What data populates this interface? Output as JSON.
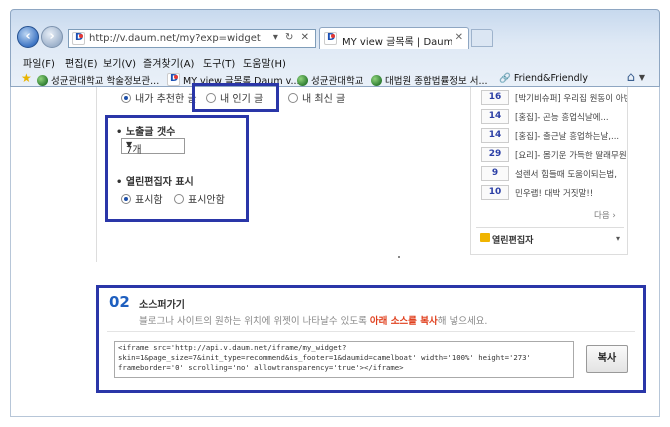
{
  "browser": {
    "address_url": "http://v.daum.net/my?exp=widget",
    "address_controls": "▾ ↻ ✕",
    "tab_title": "MY view 글목록 | Daum vi...",
    "tab_close": "✕",
    "menu": [
      "파일(F)",
      "편집(E)",
      "보기(V)",
      "즐겨찾기(A)",
      "도구(T)",
      "도움말(H)"
    ],
    "favorites": [
      {
        "label": "성균관대학교 학술정보관...",
        "icon": "globe-icon"
      },
      {
        "label": "MY view 글목록 Daum v...",
        "icon": "daum-icon"
      },
      {
        "label": "성균관대학교",
        "icon": "globe-icon"
      },
      {
        "label": "대법원 종합법률정보 서...",
        "icon": "globe-icon"
      },
      {
        "label": "Friend&Friendly",
        "icon": "link-icon"
      }
    ]
  },
  "widget_options": {
    "list_type": {
      "options": [
        "내가 추천한 글",
        "내 인기 글",
        "내 최신 글"
      ],
      "selected": "내가 추천한 글"
    },
    "count": {
      "label": "노출글 갯수",
      "value": "7개"
    },
    "editor_display": {
      "label": "열린편집자 표시",
      "options": [
        "표시함",
        "표시안함"
      ],
      "selected": "표시함"
    }
  },
  "preview_list": {
    "items": [
      {
        "count": "16",
        "title": "[박기비슈퍼] 우리집 원동이 아빈"
      },
      {
        "count": "14",
        "title": "[홍집]- 곤능 흥업식날에..."
      },
      {
        "count": "14",
        "title": "[홍집]- 출근날 흥업하는날,..."
      },
      {
        "count": "29",
        "title": "[요리]- 몸기운 가득한 딸래무원..."
      },
      {
        "count": "9",
        "title": "설렌서 힘들때 도움이되는법,"
      },
      {
        "count": "10",
        "title": "민우랩! 대박 거짓말!!"
      }
    ],
    "more_label": "다음 ›",
    "editor_label": "열린편집자",
    "editor_drop": "▾"
  },
  "step2": {
    "number": "02",
    "title": "소스퍼가기",
    "desc_before": "블로그나 사이트의 원하는 위치에 위젯이 나타날수 있도록 ",
    "desc_highlight": "아래 소스를 복사",
    "desc_after": "해 넣으세요.",
    "code_lines": [
      "<iframe src='http://api.v.daum.net/iframe/my_widget?",
      "skin=1&page_size=7&init_type=recommend&is_footer=1&daumid=camelboat' width='100%' height='273'",
      "frameborder='0' scrolling='no' allowtransparency='true'></iframe>"
    ],
    "copy_label": "복사"
  },
  "colors": {
    "highlight_border": "#2a36a8",
    "accent_blue": "#1e5fbf",
    "accent_red": "#e0401e"
  }
}
